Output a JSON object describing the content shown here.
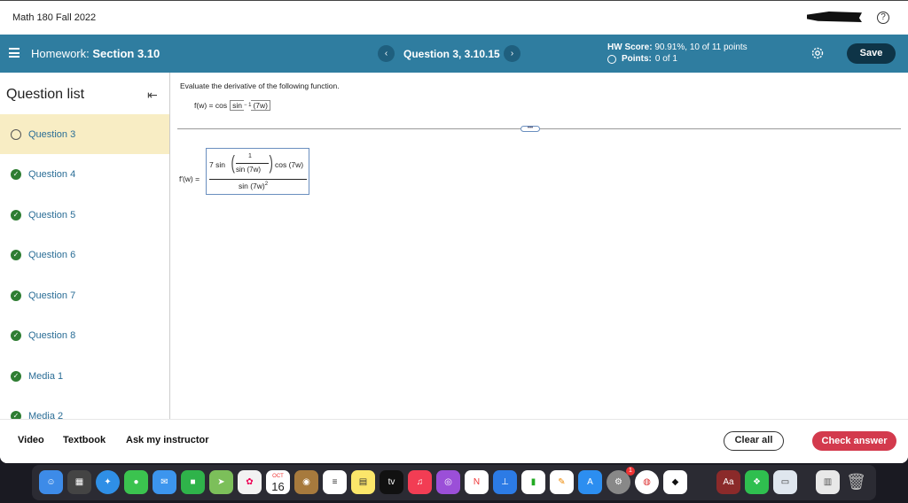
{
  "topbar": {
    "course_title": "Math 180 Fall 2022",
    "help_glyph": "?"
  },
  "header": {
    "homework_prefix": "Homework:",
    "homework_section": "Section 3.10",
    "question_title": "Question 3, 3.10.15",
    "hw_score_label": "HW Score:",
    "hw_score_value": "90.91%, 10 of 11 points",
    "points_label": "Points:",
    "points_value": "0 of 1",
    "save_label": "Save",
    "prev_glyph": "‹",
    "next_glyph": "›"
  },
  "sidebar": {
    "title": "Question list",
    "collapse_glyph": "⇤",
    "items": [
      {
        "label": "Question 3",
        "status": "open",
        "active": true
      },
      {
        "label": "Question 4",
        "status": "done",
        "active": false
      },
      {
        "label": "Question 5",
        "status": "done",
        "active": false
      },
      {
        "label": "Question 6",
        "status": "done",
        "active": false
      },
      {
        "label": "Question 7",
        "status": "done",
        "active": false
      },
      {
        "label": "Question 8",
        "status": "done",
        "active": false
      },
      {
        "label": "Media 1",
        "status": "done",
        "active": false
      },
      {
        "label": "Media 2",
        "status": "done",
        "active": false
      }
    ]
  },
  "content": {
    "instruction": "Evaluate the derivative of the following function.",
    "function_lhs": "f(w) = cos",
    "function_inner": "sin",
    "function_exp": "− 1",
    "function_arg": "(7w)",
    "dots_glyph": "•••",
    "answer_lhs": "f′(w) =",
    "answer": {
      "coef": "7 sin",
      "frac_num": "1",
      "frac_den": "sin (7w)",
      "times": "cos (7w)",
      "denominator": "sin (7w)",
      "den_exp": "2"
    }
  },
  "bottombar": {
    "video_label": "Video",
    "textbook_label": "Textbook",
    "ask_label": "Ask my instructor",
    "clear_label": "Clear all",
    "check_label": "Check answer"
  },
  "dock": {
    "calendar_month": "OCT",
    "calendar_day": "16",
    "tv_label": "tv",
    "dictionary_label": "Aa",
    "badge_count": "1"
  },
  "colors": {
    "header_blue": "#2f7da0",
    "save_dark": "#0e3447",
    "check_red": "#d33a4d",
    "done_green": "#2e7d32",
    "active_row": "#f8edc4",
    "link_blue": "#2a6d96"
  }
}
